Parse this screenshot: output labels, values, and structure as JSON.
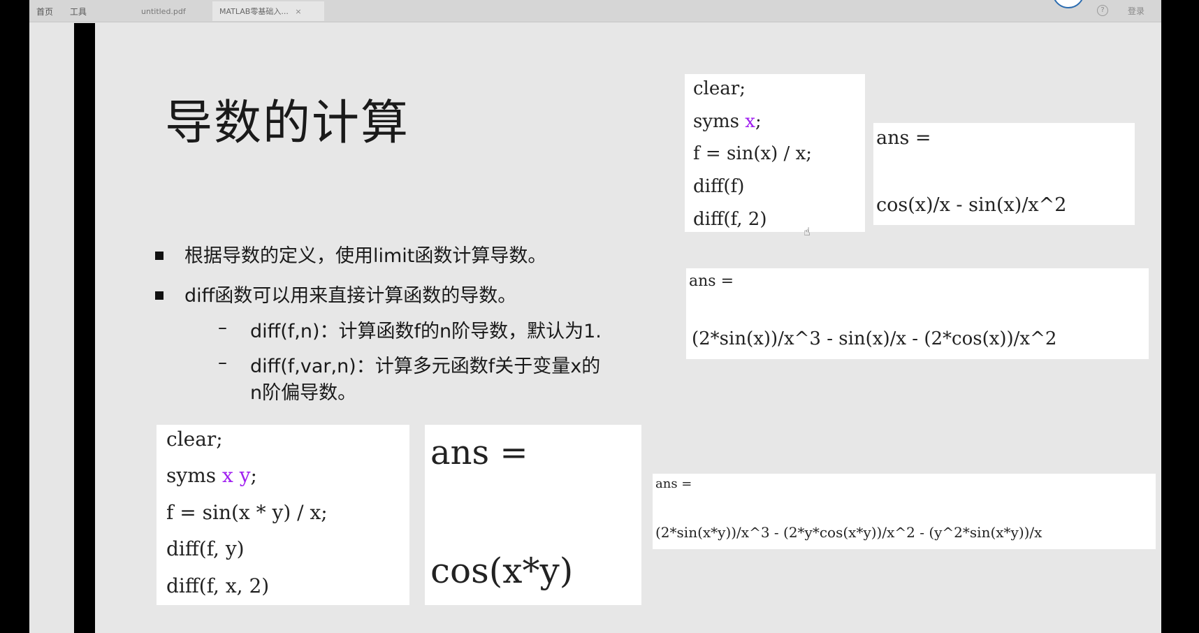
{
  "topbar": {
    "menu": [
      "首页",
      "工具"
    ],
    "tabs": [
      {
        "label": "untitled.pdf",
        "active": false
      },
      {
        "label": "MATLAB零基础入...",
        "active": true
      }
    ],
    "close_glyph": "×",
    "help_glyph": "?",
    "login_label": "登录"
  },
  "slide": {
    "title": "导数的计算",
    "bullets": [
      "根据导数的定义，使用limit函数计算导数。",
      "diff函数可以用来直接计算函数的导数。"
    ],
    "sub_bullets": [
      "diff(f,n)：计算函数f的n阶导数，默认为1.",
      "diff(f,var,n)：计算多元函数f关于变量x的",
      "n阶偏导数。"
    ],
    "code1": {
      "l1": "clear;",
      "l2_pre": "syms ",
      "l2_var": "x",
      "l2_post": ";",
      "l3": "f = sin(x) / x;",
      "l4": "diff(f)",
      "l5": "diff(f, 2)"
    },
    "result1": {
      "label": "ans =",
      "expr": "cos(x)/x - sin(x)/x^2"
    },
    "result2": {
      "label": "ans =",
      "expr": "(2*sin(x))/x^3 - sin(x)/x - (2*cos(x))/x^2"
    },
    "code2": {
      "l1": "clear;",
      "l2_pre": "syms ",
      "l2_var": "x y",
      "l2_post": ";",
      "l3": "f = sin(x * y) / x;",
      "l4": "diff(f, y)",
      "l5": "diff(f, x, 2)"
    },
    "result3": {
      "label": "ans =",
      "expr": "cos(x*y)"
    },
    "result4": {
      "label": "ans =",
      "expr": "(2*sin(x*y))/x^3 - (2*y*cos(x*y))/x^2 - (y^2*sin(x*y))/x"
    }
  },
  "colors": {
    "variable": "#a020f0",
    "background": "#e7e7e7"
  }
}
